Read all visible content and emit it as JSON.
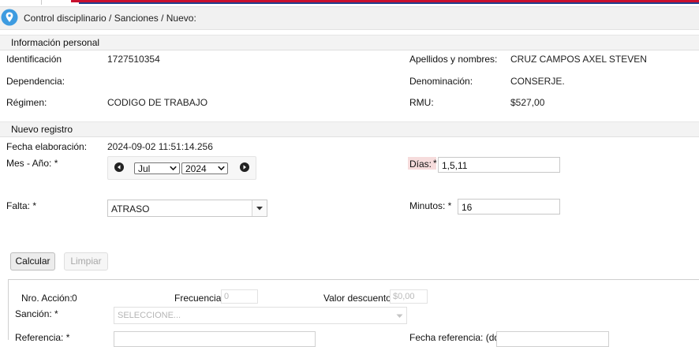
{
  "breadcrumb": "Control disciplinario / Sanciones / Nuevo:",
  "personal": {
    "header": "Información personal",
    "identificacion_label": "Identificación",
    "identificacion_value": "1727510354",
    "apellidos_label": "Apellidos y nombres:",
    "apellidos_value": "CRUZ CAMPOS AXEL STEVEN",
    "dependencia_label": "Dependencia:",
    "denominacion_label": "Denominación:",
    "denominacion_value": "CONSERJE.",
    "regimen_label": "Régimen:",
    "regimen_value": "CODIGO DE TRABAJO",
    "rmu_label": "RMU:",
    "rmu_value": "$527,00"
  },
  "registro": {
    "header": "Nuevo registro",
    "fecha_label": "Fecha elaboración:",
    "fecha_value": "2024-09-02 11:51:14.256",
    "mes_label": "Mes - Año: *",
    "month_value": "Jul",
    "year_value": "2024",
    "dias_label": "Días:",
    "dias_req": "*",
    "dias_value": "1,5,11",
    "falta_label": "Falta:  *",
    "falta_value": "ATRASO",
    "minutos_label": "Minutos:  *",
    "minutos_value": "16"
  },
  "buttons": {
    "calcular": "Calcular",
    "limpiar": "Limpiar"
  },
  "accion": {
    "nro_label": "Nro. Acción:",
    "nro_value": "0",
    "frecuencia_label": "Frecuencia:",
    "frecuencia_value": "0",
    "valor_label": "Valor descuento:",
    "valor_value": "$0,00",
    "sancion_label": "Sanción:  *",
    "sancion_placeholder": "SELECCIONE...",
    "referencia_label": "Referencia:  *",
    "fecha_ref_label": "Fecha referencia: (dd-"
  },
  "colors": {
    "required_highlight": "#f6dcdc",
    "brand_red": "#c8102e",
    "brand_blue": "#1f3f8f",
    "pin_blue": "#3d9be0"
  }
}
